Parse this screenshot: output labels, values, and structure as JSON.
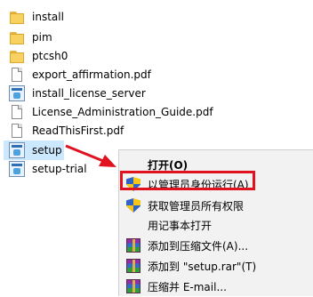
{
  "files": [
    {
      "name": "install",
      "icon": "folder-icon"
    },
    {
      "name": "pim",
      "icon": "folder-icon"
    },
    {
      "name": "ptcsh0",
      "icon": "folder-icon"
    },
    {
      "name": "export_affirmation.pdf",
      "icon": "document-icon"
    },
    {
      "name": "install_license_server",
      "icon": "installer-icon"
    },
    {
      "name": "License_Administration_Guide.pdf",
      "icon": "document-icon"
    },
    {
      "name": "ReadThisFirst.pdf",
      "icon": "document-icon"
    },
    {
      "name": "setup",
      "icon": "installer-icon",
      "selected": true
    },
    {
      "name": "setup-trial",
      "icon": "installer-icon"
    }
  ],
  "context_menu": {
    "items": [
      {
        "label": "打开(O)",
        "icon": "",
        "bold": true
      },
      {
        "label": "以管理员身份运行(A)",
        "icon": "uac-shield-icon",
        "highlighted": true
      },
      {
        "label": "获取管理员所有权限",
        "icon": "uac-shield-icon"
      },
      {
        "label": "用记事本打开",
        "icon": ""
      },
      {
        "label": "添加到压缩文件(A)...",
        "icon": "winrar-icon"
      },
      {
        "label": "添加到 \"setup.rar\"(T)",
        "icon": "winrar-icon"
      },
      {
        "label": "压缩并 E-mail...",
        "icon": "winrar-icon"
      }
    ]
  },
  "annotation": {
    "arrow_color": "#e0121f",
    "highlight_color": "#e0121f"
  }
}
